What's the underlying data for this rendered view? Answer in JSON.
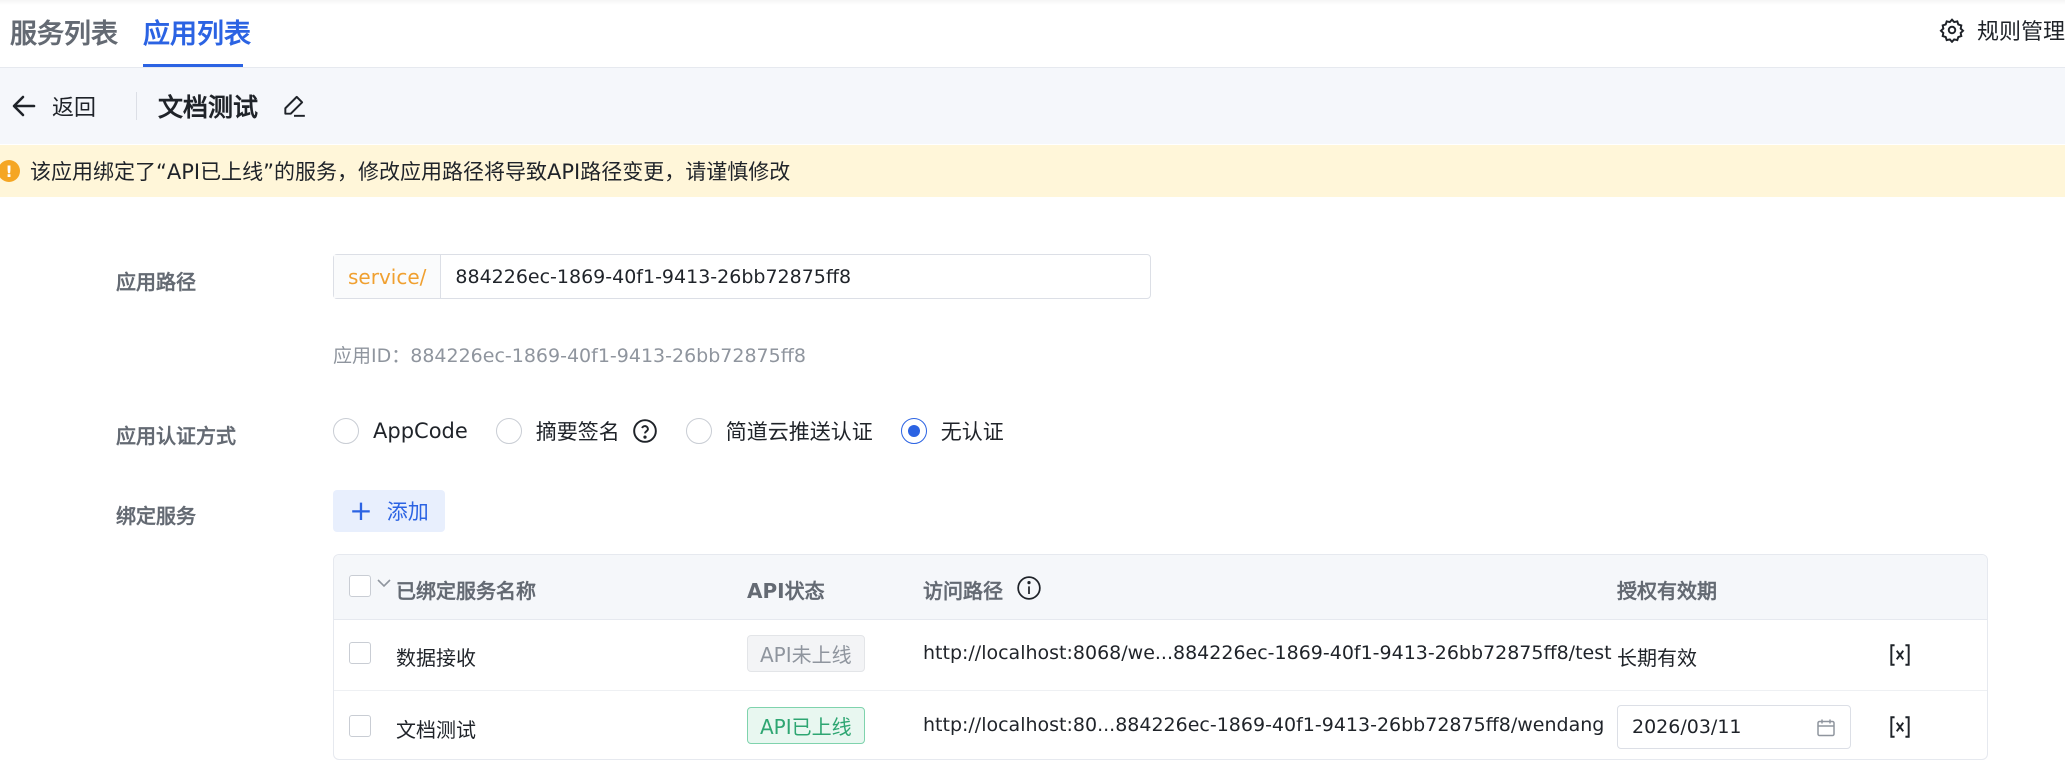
{
  "tabs": {
    "service_list": "服务列表",
    "app_list": "应用列表"
  },
  "header_right": {
    "rules_label": "规则管理"
  },
  "subbar": {
    "back_label": "返回",
    "app_name": "文档测试"
  },
  "warning": {
    "text": "该应用绑定了“API已上线”的服务，修改应用路径将导致API路径变更，请谨慎修改"
  },
  "form": {
    "path_label": "应用路径",
    "path_prefix": "service/",
    "path_value": "884226ec-1869-40f1-9413-26bb72875ff8",
    "app_id_text": "应用ID：884226ec-1869-40f1-9413-26bb72875ff8",
    "auth_label": "应用认证方式",
    "auth_options": [
      "AppCode",
      "摘要签名",
      "简道云推送认证",
      "无认证"
    ],
    "auth_selected": "无认证",
    "bind_label": "绑定服务",
    "add_label": "添加"
  },
  "table": {
    "headers": {
      "name": "已绑定服务名称",
      "status": "API状态",
      "path": "访问路径",
      "validity": "授权有效期"
    },
    "rows": [
      {
        "name": "数据接收",
        "status": "API未上线",
        "path": "http://localhost:8068/we...884226ec-1869-40f1-9413-26bb72875ff8/test",
        "validity": "长期有效"
      },
      {
        "name": "文档测试",
        "status": "API已上线",
        "path": "http://localhost:80...884226ec-1869-40f1-9413-26bb72875ff8/wendang",
        "validity": "2026/03/11"
      }
    ]
  },
  "colors": {
    "primary": "#2b63e3",
    "warning_bg": "#fff6d9",
    "warning_icon": "#f5a623",
    "online_green": "#2ea672",
    "prefix_orange": "#f0a030"
  }
}
